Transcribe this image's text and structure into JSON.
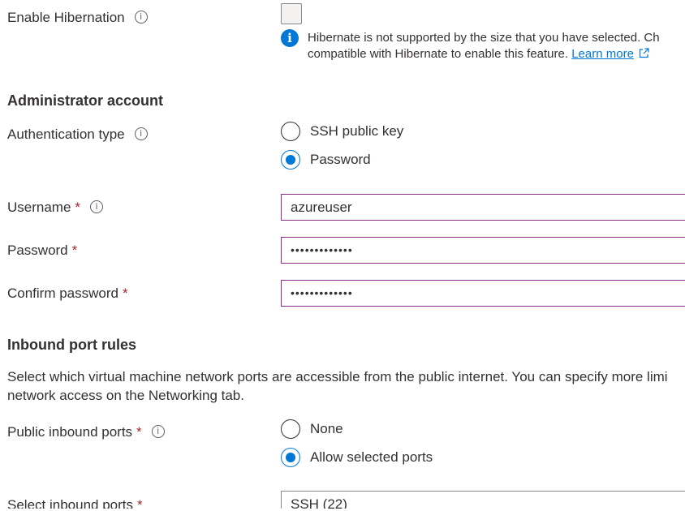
{
  "hibernation": {
    "label": "Enable Hibernation",
    "notice_line1": "Hibernate is not supported by the size that you have selected. Ch",
    "notice_line2": "compatible with Hibernate to enable this feature.",
    "learn_more": "Learn more"
  },
  "admin": {
    "title": "Administrator account",
    "auth_label": "Authentication type",
    "auth_options": [
      "SSH public key",
      "Password"
    ],
    "auth_selected": "Password",
    "username_label": "Username",
    "username_value": "azureuser",
    "password_label": "Password",
    "password_value": "•••••••••••••",
    "confirm_label": "Confirm password",
    "confirm_value": "•••••••••••••",
    "required_mark": "*"
  },
  "inbound": {
    "title": "Inbound port rules",
    "desc_line1": "Select which virtual machine network ports are accessible from the public internet. You can specify more limi",
    "desc_line2": "network access on the Networking tab.",
    "public_label": "Public inbound ports",
    "public_options": [
      "None",
      "Allow selected ports"
    ],
    "public_selected": "Allow selected ports",
    "select_label": "Select inbound ports",
    "select_value": "SSH (22)"
  },
  "icons": {
    "info": "i",
    "info_badge": "i"
  },
  "colors": {
    "accent": "#0078d4",
    "required": "#a4262c",
    "input_border": "#8a2d8a"
  }
}
